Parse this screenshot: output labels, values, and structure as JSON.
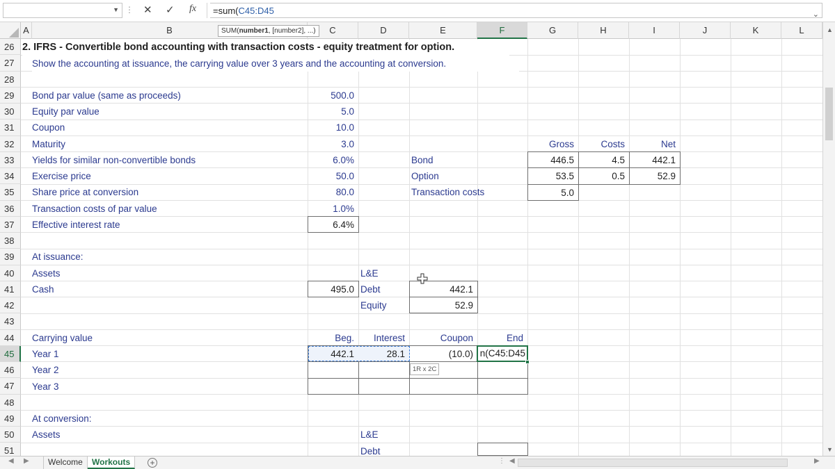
{
  "formula_bar": {
    "name_box": "",
    "formula_prefix": "=sum(",
    "formula_ref": "C45:D45"
  },
  "tooltip": {
    "fn": "SUM(",
    "arg1": "number1",
    "rest": ", [number2], ...)"
  },
  "columns": [
    "A",
    "B",
    "C",
    "D",
    "E",
    "F",
    "G",
    "H",
    "I",
    "J",
    "K",
    "L"
  ],
  "rows": [
    "26",
    "27",
    "28",
    "29",
    "30",
    "31",
    "32",
    "33",
    "34",
    "35",
    "36",
    "37",
    "38",
    "39",
    "40",
    "41",
    "42",
    "43",
    "44",
    "45",
    "46",
    "47",
    "48",
    "49",
    "50",
    "51"
  ],
  "sheet": {
    "title": "2. IFRS - Convertible bond accounting with transaction costs - equity treatment for option.",
    "subtitle": "Show the accounting at issuance, the carrying value over 3 years and the accounting at conversion.",
    "inputs": [
      {
        "label": "Bond par value (same as proceeds)",
        "value": "500.0"
      },
      {
        "label": "Equity par value",
        "value": "5.0"
      },
      {
        "label": "Coupon",
        "value": "10.0"
      },
      {
        "label": "Maturity",
        "value": "3.0"
      },
      {
        "label": "Yields for similar non-convertible bonds",
        "value": "6.0%"
      },
      {
        "label": "Exercise price",
        "value": "50.0"
      },
      {
        "label": "Share price at conversion",
        "value": "80.0"
      },
      {
        "label": "Transaction costs of par value",
        "value": "1.0%"
      },
      {
        "label": "Effective interest rate",
        "value": "6.4%"
      }
    ],
    "split": {
      "labels": [
        "Bond",
        "Option",
        "Transaction costs"
      ],
      "headers": [
        "Gross",
        "Costs",
        "Net"
      ],
      "rows": [
        [
          "446.5",
          "4.5",
          "442.1"
        ],
        [
          "53.5",
          "0.5",
          "52.9"
        ],
        [
          "5.0",
          "",
          ""
        ]
      ]
    },
    "issuance": {
      "heading": "At issuance:",
      "assets": "Assets",
      "le": "L&E",
      "cash_label": "Cash",
      "cash_value": "495.0",
      "debt_label": "Debt",
      "debt_value": "442.1",
      "equity_label": "Equity",
      "equity_value": "52.9"
    },
    "carrying": {
      "heading": "Carrying value",
      "headers": [
        "Beg.",
        "Interest",
        "Coupon",
        "End"
      ],
      "years": [
        "Year 1",
        "Year 2",
        "Year 3"
      ],
      "year1": [
        "442.1",
        "28.1",
        "(10.0)",
        "n(C45:D45"
      ]
    },
    "conversion": {
      "heading": "At conversion:",
      "assets": "Assets",
      "le": "L&E",
      "debt": "Debt"
    },
    "range_tip": "1R x 2C"
  },
  "tabs": [
    "Welcome",
    "Workouts"
  ],
  "active_tab": "Workouts",
  "colors": {
    "accent": "#217346",
    "label_blue": "#2b3a8f",
    "ref_blue": "#2e5fa8"
  }
}
